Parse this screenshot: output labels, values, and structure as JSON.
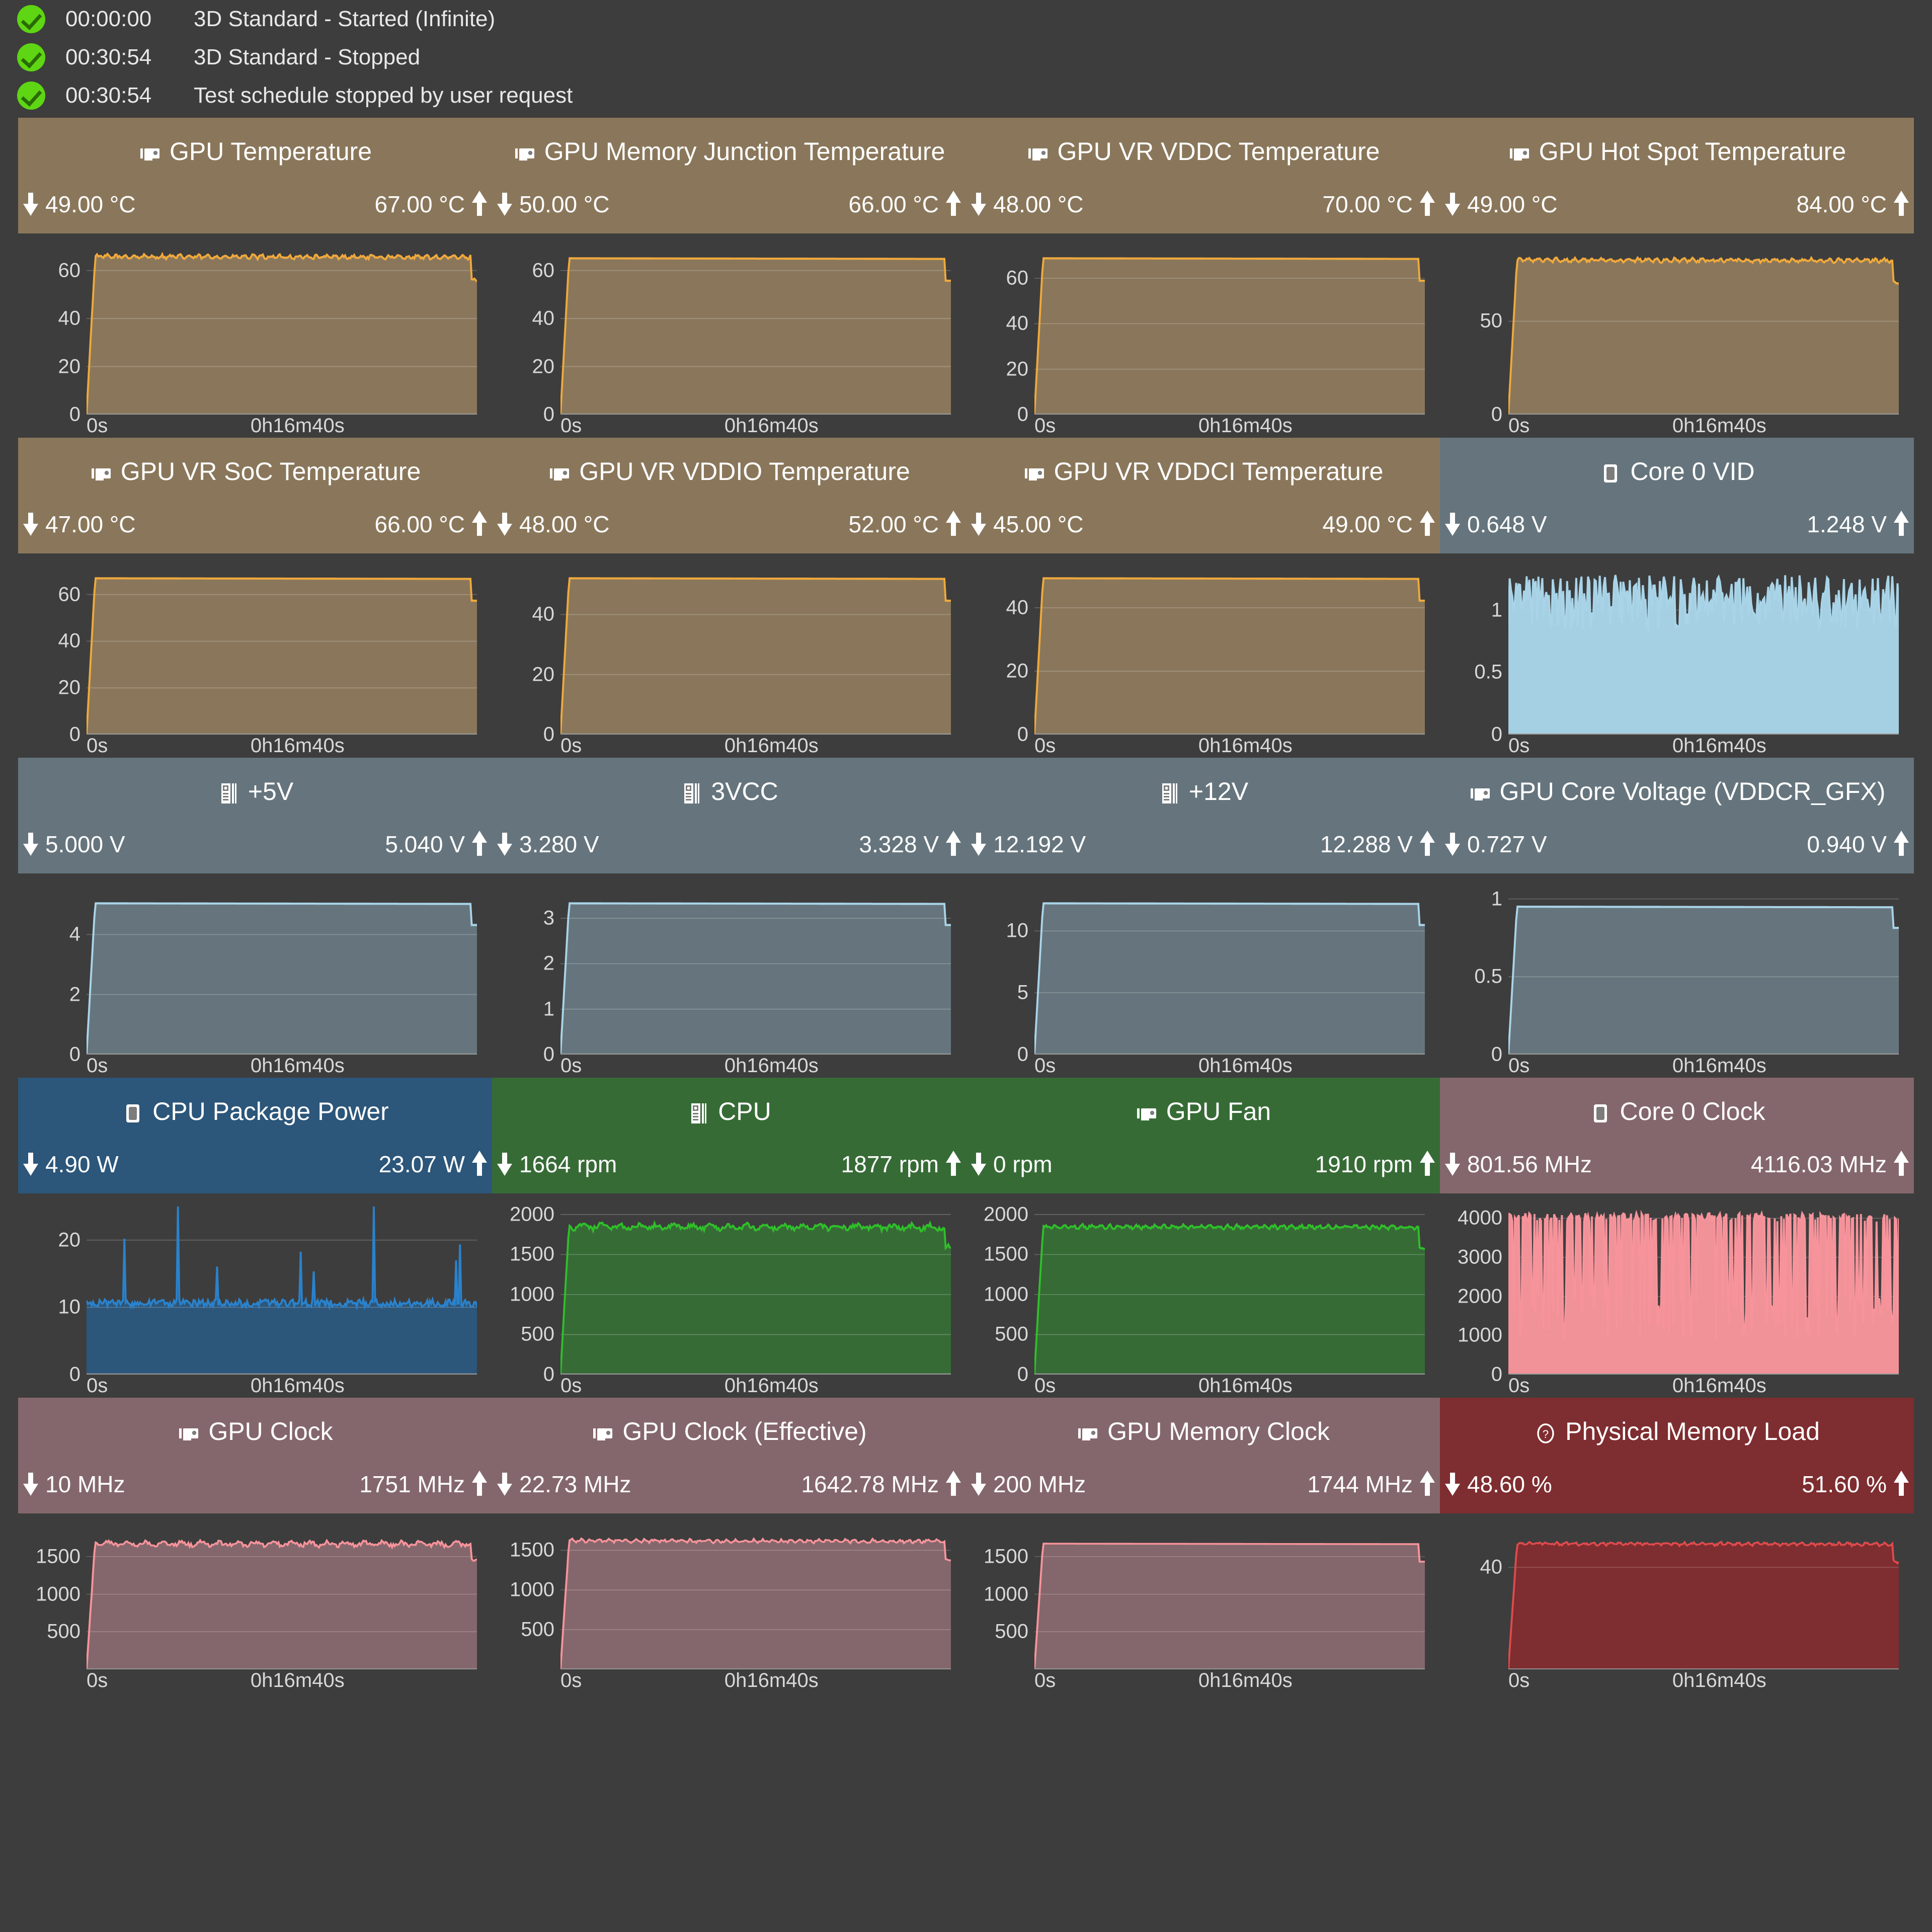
{
  "log": [
    {
      "time": "00:00:00",
      "message": "3D Standard - Started (Infinite)"
    },
    {
      "time": "00:30:54",
      "message": "3D Standard - Stopped"
    },
    {
      "time": "00:30:54",
      "message": "Test schedule stopped by user request"
    }
  ],
  "axis": {
    "left": "0s",
    "right": "0h16m40s"
  },
  "colors": {
    "background": "#3d3d3d",
    "temp_panel": "#8a775b",
    "temp_line": "#f0a93c",
    "volt_panel": "#66757d",
    "volt_line": "#a9d4e8",
    "power_panel": "#2c567a",
    "power_line": "#2a82cc",
    "fan_panel": "#376b36",
    "fan_line": "#2fbf2a",
    "clock_panel": "#84676c",
    "clock_line": "#f7939b",
    "memory_panel": "#7e2d30",
    "memory_line": "#e04a4c",
    "check_green": "#5ed613"
  },
  "panels": [
    {
      "name": "gpu-temperature",
      "title": "GPU Temperature",
      "icon": "gpu-icon",
      "theme": "temp",
      "min": "49.00 °C",
      "max": "67.00 °C",
      "chart": {
        "type": "area",
        "yticks": [
          0,
          20,
          40,
          60
        ],
        "ylim": [
          0,
          70
        ],
        "plateau": 0.94,
        "ripple": "fine"
      }
    },
    {
      "name": "gpu-memory-junction-temperature",
      "title": "GPU Memory Junction Temperature",
      "icon": "gpu-icon",
      "theme": "temp",
      "min": "50.00 °C",
      "max": "66.00 °C",
      "chart": {
        "type": "area",
        "yticks": [
          0,
          20,
          40,
          60
        ],
        "ylim": [
          0,
          70
        ],
        "plateau": 0.93,
        "ripple": "none"
      }
    },
    {
      "name": "gpu-vr-vddc-temperature",
      "title": "GPU VR VDDC Temperature",
      "icon": "gpu-icon",
      "theme": "temp",
      "min": "48.00 °C",
      "max": "70.00 °C",
      "chart": {
        "type": "area",
        "yticks": [
          0,
          20,
          40,
          60
        ],
        "ylim": [
          0,
          74
        ],
        "plateau": 0.93,
        "ripple": "none"
      }
    },
    {
      "name": "gpu-hot-spot-temperature",
      "title": "GPU Hot Spot Temperature",
      "icon": "gpu-icon",
      "theme": "temp",
      "min": "49.00 °C",
      "max": "84.00 °C",
      "chart": {
        "type": "area",
        "yticks": [
          0,
          50
        ],
        "ylim": [
          0,
          90
        ],
        "plateau": 0.92,
        "ripple": "fine"
      }
    },
    {
      "name": "gpu-vr-soc-temperature",
      "title": "GPU VR SoC Temperature",
      "icon": "gpu-icon",
      "theme": "temp",
      "min": "47.00 °C",
      "max": "66.00 °C",
      "chart": {
        "type": "area",
        "yticks": [
          0,
          20,
          40,
          60
        ],
        "ylim": [
          0,
          72
        ],
        "plateau": 0.93,
        "ripple": "none"
      }
    },
    {
      "name": "gpu-vr-vddio-temperature",
      "title": "GPU VR VDDIO Temperature",
      "icon": "gpu-icon",
      "theme": "temp",
      "min": "48.00 °C",
      "max": "52.00 °C",
      "chart": {
        "type": "area",
        "yticks": [
          0,
          20,
          40
        ],
        "ylim": [
          0,
          56
        ],
        "plateau": 0.93,
        "ripple": "none"
      }
    },
    {
      "name": "gpu-vr-vddci-temperature",
      "title": "GPU VR VDDCI Temperature",
      "icon": "gpu-icon",
      "theme": "temp",
      "min": "45.00 °C",
      "max": "49.00 °C",
      "chart": {
        "type": "area",
        "yticks": [
          0,
          20,
          40
        ],
        "ylim": [
          0,
          53
        ],
        "plateau": 0.93,
        "ripple": "none"
      }
    },
    {
      "name": "core-0-vid",
      "title": "Core 0 VID",
      "icon": "cpu-icon",
      "theme": "volt",
      "min": "0.648 V",
      "max": "1.248 V",
      "chart": {
        "type": "noise",
        "yticks": [
          0,
          0.5,
          1
        ],
        "ylim": [
          0,
          1.35
        ],
        "base": 0.62,
        "peak": 0.95,
        "density": "high"
      }
    },
    {
      "name": "plus-5v",
      "title": "+5V",
      "icon": "mainboard-icon",
      "theme": "volt",
      "min": "5.000 V",
      "max": "5.040 V",
      "chart": {
        "type": "area",
        "yticks": [
          0,
          2,
          4
        ],
        "ylim": [
          0,
          5.6
        ],
        "plateau": 0.9,
        "ripple": "none"
      }
    },
    {
      "name": "3vcc",
      "title": "3VCC",
      "icon": "mainboard-icon",
      "theme": "volt",
      "min": "3.280 V",
      "max": "3.328 V",
      "chart": {
        "type": "area",
        "yticks": [
          0,
          1,
          2,
          3
        ],
        "ylim": [
          0,
          3.7
        ],
        "plateau": 0.9,
        "ripple": "none"
      }
    },
    {
      "name": "plus-12v",
      "title": "+12V",
      "icon": "mainboard-icon",
      "theme": "volt",
      "min": "12.192 V",
      "max": "12.288 V",
      "chart": {
        "type": "area",
        "yticks": [
          0,
          5,
          10
        ],
        "ylim": [
          0,
          13.6
        ],
        "plateau": 0.9,
        "ripple": "none"
      }
    },
    {
      "name": "gpu-core-voltage",
      "title": "GPU Core Voltage (VDDCR_GFX)",
      "icon": "gpu-icon",
      "theme": "volt",
      "min": "0.727 V",
      "max": "0.940 V",
      "chart": {
        "type": "area",
        "yticks": [
          0,
          0.5,
          1
        ],
        "ylim": [
          0,
          1.08
        ],
        "plateau": 0.88,
        "ripple": "none"
      }
    },
    {
      "name": "cpu-package-power",
      "title": "CPU Package Power",
      "icon": "cpu-icon",
      "theme": "power",
      "min": "4.90 W",
      "max": "23.07 W",
      "chart": {
        "type": "spiky",
        "yticks": [
          0,
          10,
          20
        ],
        "ylim": [
          0,
          25
        ],
        "base": 0.42,
        "spikes": "tall"
      }
    },
    {
      "name": "cpu-fan",
      "title": "CPU",
      "icon": "mainboard-icon",
      "theme": "fan",
      "min": "1664 rpm",
      "max": "1877 rpm",
      "chart": {
        "type": "area",
        "yticks": [
          0,
          500,
          1000,
          1500,
          2000
        ],
        "ylim": [
          0,
          2100
        ],
        "plateau": 0.88,
        "ripple": "medium"
      }
    },
    {
      "name": "gpu-fan",
      "title": "GPU Fan",
      "icon": "gpu-icon",
      "theme": "fan",
      "min": "0 rpm",
      "max": "1910 rpm",
      "chart": {
        "type": "area",
        "yticks": [
          0,
          500,
          1000,
          1500,
          2000
        ],
        "ylim": [
          0,
          2100
        ],
        "plateau": 0.88,
        "ripple": "fine"
      }
    },
    {
      "name": "core-0-clock",
      "title": "Core 0 Clock",
      "icon": "cpu-icon",
      "theme": "clock",
      "min": "801.56 MHz",
      "max": "4116.03 MHz",
      "chart": {
        "type": "noise",
        "yticks": [
          0,
          1000,
          2000,
          3000,
          4000
        ],
        "ylim": [
          0,
          4300
        ],
        "base": 0.21,
        "peak": 0.96,
        "density": "blocky"
      }
    },
    {
      "name": "gpu-clock",
      "title": "GPU Clock",
      "icon": "gpu-icon",
      "theme": "clock",
      "min": "10 MHz",
      "max": "1751 MHz",
      "chart": {
        "type": "area",
        "yticks": [
          500,
          1000,
          1500
        ],
        "ylim": [
          0,
          1900
        ],
        "plateau": 0.88,
        "ripple": "medium"
      }
    },
    {
      "name": "gpu-clock-effective",
      "title": "GPU Clock (Effective)",
      "icon": "gpu-icon",
      "theme": "clock",
      "min": "22.73 MHz",
      "max": "1642.78 MHz",
      "chart": {
        "type": "area",
        "yticks": [
          500,
          1000,
          1500
        ],
        "ylim": [
          0,
          1800
        ],
        "plateau": 0.9,
        "ripple": "fine"
      }
    },
    {
      "name": "gpu-memory-clock",
      "title": "GPU Memory Clock",
      "icon": "gpu-icon",
      "theme": "clock",
      "min": "200 MHz",
      "max": "1744 MHz",
      "chart": {
        "type": "area",
        "yticks": [
          500,
          1000,
          1500
        ],
        "ylim": [
          0,
          1900
        ],
        "plateau": 0.88,
        "ripple": "none"
      }
    },
    {
      "name": "physical-memory-load",
      "title": "Physical Memory Load",
      "icon": "question-icon",
      "theme": "memory",
      "min": "48.60 %",
      "max": "51.60 %",
      "chart": {
        "type": "area",
        "yticks": [
          40
        ],
        "ylim": [
          0,
          56
        ],
        "plateau": 0.88,
        "ripple": "fine"
      }
    }
  ],
  "chart_data": {
    "type": "area",
    "x": {
      "label_left": "0s",
      "label_right": "0h16m40s",
      "range_seconds": [
        0,
        1000
      ]
    },
    "series": [
      {
        "name": "GPU Temperature",
        "unit": "°C",
        "min": 49.0,
        "max": 67.0,
        "yticks": [
          0,
          20,
          40,
          60
        ],
        "shape": "rises to ~66 then flat with fine ripple, drops at end"
      },
      {
        "name": "GPU Memory Junction Temperature",
        "unit": "°C",
        "min": 50.0,
        "max": 66.0,
        "yticks": [
          0,
          20,
          40,
          60
        ],
        "shape": "fast rise to ~65, flat"
      },
      {
        "name": "GPU VR VDDC Temperature",
        "unit": "°C",
        "min": 48.0,
        "max": 70.0,
        "yticks": [
          0,
          20,
          40,
          60
        ],
        "shape": "fast rise to ~69, flat"
      },
      {
        "name": "GPU Hot Spot Temperature",
        "unit": "°C",
        "min": 49.0,
        "max": 84.0,
        "yticks": [
          0,
          50
        ],
        "shape": "rise to ~82, flat with ripple"
      },
      {
        "name": "GPU VR SoC Temperature",
        "unit": "°C",
        "min": 47.0,
        "max": 66.0,
        "yticks": [
          0,
          20,
          40,
          60
        ],
        "shape": "fast rise to ~65, flat"
      },
      {
        "name": "GPU VR VDDIO Temperature",
        "unit": "°C",
        "min": 48.0,
        "max": 52.0,
        "yticks": [
          0,
          20,
          40
        ],
        "shape": "fast rise to ~51, flat"
      },
      {
        "name": "GPU VR VDDCI Temperature",
        "unit": "°C",
        "min": 45.0,
        "max": 49.0,
        "yticks": [
          0,
          20,
          40
        ],
        "shape": "fast rise to ~48, flat"
      },
      {
        "name": "Core 0 VID",
        "unit": "V",
        "min": 0.648,
        "max": 1.248,
        "yticks": [
          0,
          0.5,
          1
        ],
        "shape": "dense noise band between 0.65 and 1.25"
      },
      {
        "name": "+5V",
        "unit": "V",
        "min": 5.0,
        "max": 5.04,
        "yticks": [
          0,
          2,
          4
        ],
        "shape": "flat ~5.0"
      },
      {
        "name": "3VCC",
        "unit": "V",
        "min": 3.28,
        "max": 3.328,
        "yticks": [
          0,
          1,
          2,
          3
        ],
        "shape": "flat ~3.3"
      },
      {
        "name": "+12V",
        "unit": "V",
        "min": 12.192,
        "max": 12.288,
        "yticks": [
          0,
          5,
          10
        ],
        "shape": "flat ~12.2"
      },
      {
        "name": "GPU Core Voltage (VDDCR_GFX)",
        "unit": "V",
        "min": 0.727,
        "max": 0.94,
        "yticks": [
          0,
          0.5,
          1
        ],
        "shape": "flat ~0.93"
      },
      {
        "name": "CPU Package Power",
        "unit": "W",
        "min": 4.9,
        "max": 23.07,
        "yticks": [
          0,
          10,
          20
        ],
        "shape": "noisy ~11 W with spikes up to 23 W"
      },
      {
        "name": "CPU",
        "unit": "rpm",
        "min": 1664,
        "max": 1877,
        "yticks": [
          0,
          500,
          1000,
          1500,
          2000
        ],
        "shape": "rises from ~1700 to ~1850, noisy flat"
      },
      {
        "name": "GPU Fan",
        "unit": "rpm",
        "min": 0,
        "max": 1910,
        "yticks": [
          0,
          500,
          1000,
          1500,
          2000
        ],
        "shape": "ramp to ~1850 then flat"
      },
      {
        "name": "Core 0 Clock",
        "unit": "MHz",
        "min": 801.56,
        "max": 4116.03,
        "yticks": [
          0,
          1000,
          2000,
          3000,
          4000
        ],
        "shape": "mostly ~4100 with frequent drops to ~900"
      },
      {
        "name": "GPU Clock",
        "unit": "MHz",
        "min": 10,
        "max": 1751,
        "yticks": [
          500,
          1000,
          1500
        ],
        "shape": "flat ~1700 with ripple"
      },
      {
        "name": "GPU Clock (Effective)",
        "unit": "MHz",
        "min": 22.73,
        "max": 1642.78,
        "yticks": [
          500,
          1000,
          1500
        ],
        "shape": "flat ~1630"
      },
      {
        "name": "GPU Memory Clock",
        "unit": "MHz",
        "min": 200,
        "max": 1744,
        "yticks": [
          500,
          1000,
          1500
        ],
        "shape": "flat ~1744"
      },
      {
        "name": "Physical Memory Load",
        "unit": "%",
        "min": 48.6,
        "max": 51.6,
        "yticks": [
          40
        ],
        "shape": "flat ~49 with small ripple"
      }
    ]
  }
}
